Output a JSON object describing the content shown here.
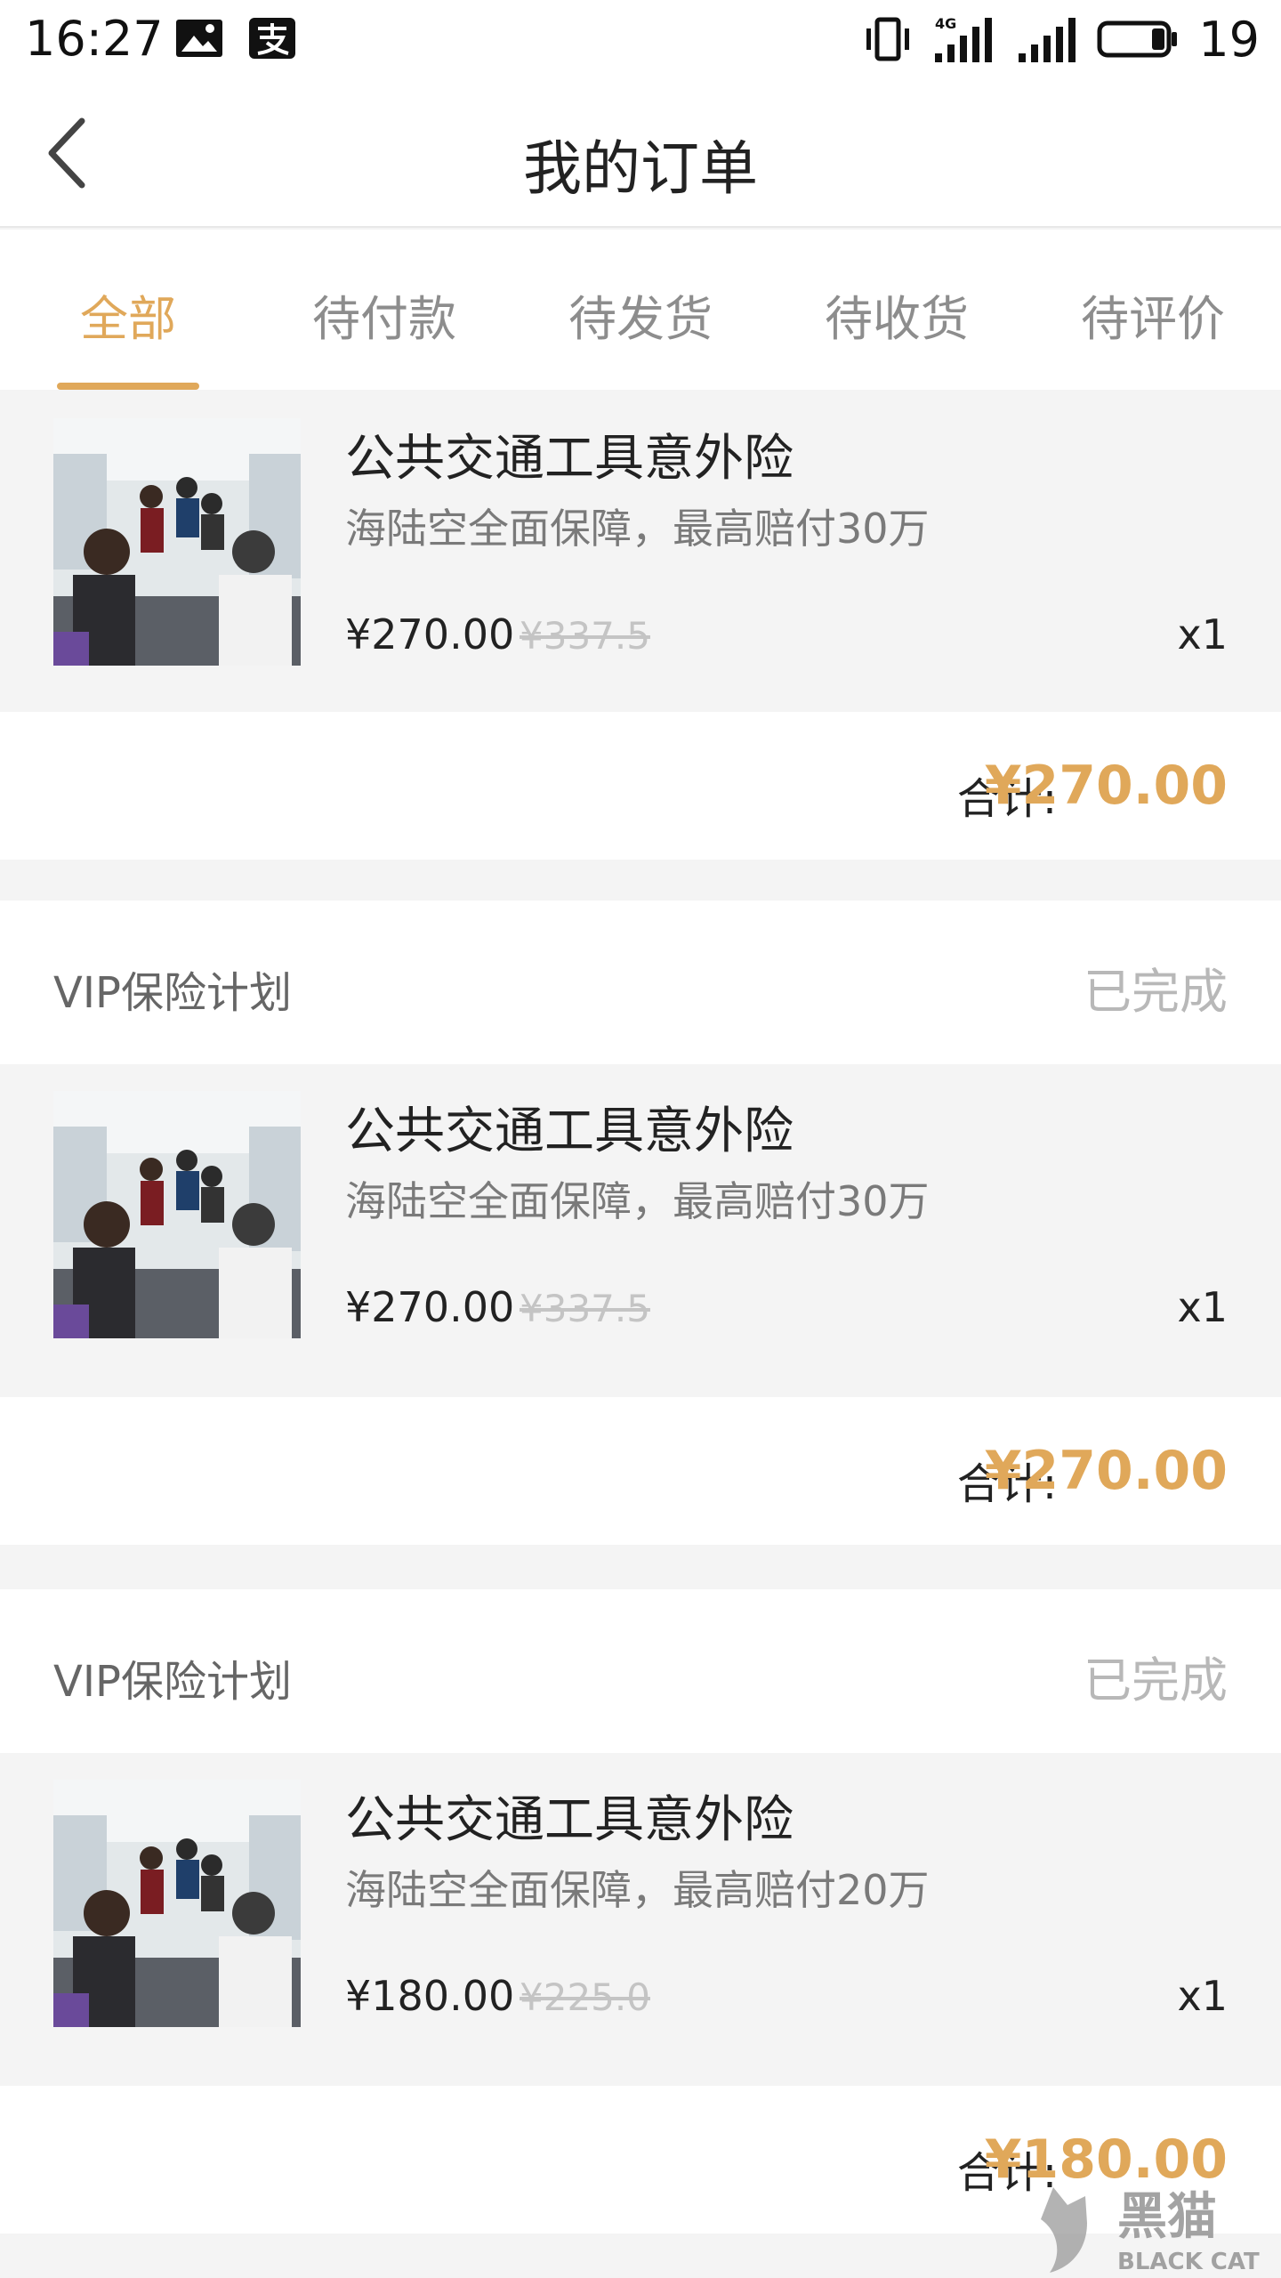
{
  "status_bar": {
    "time": "16:27",
    "battery": "19",
    "network": "4G",
    "icons": [
      "image-icon",
      "alipay-icon",
      "vibrate-icon",
      "signal-4g-icon",
      "signal-icon",
      "battery-icon"
    ]
  },
  "header": {
    "title": "我的订单",
    "back_icon": "chevron-left-icon"
  },
  "tabs": [
    {
      "label": "全部",
      "active": true
    },
    {
      "label": "待付款",
      "active": false
    },
    {
      "label": "待发货",
      "active": false
    },
    {
      "label": "待收货",
      "active": false
    },
    {
      "label": "待评价",
      "active": false
    }
  ],
  "orders": [
    {
      "product": {
        "name": "公共交通工具意外险",
        "desc": "海陆空全面保障，最高赔付30万",
        "price": "¥270.00",
        "original_price": "¥337.5",
        "qty": "x1"
      },
      "total_label": "合计:",
      "total": "¥270.00"
    },
    {
      "shop": "VIP保险计划",
      "status": "已完成",
      "product": {
        "name": "公共交通工具意外险",
        "desc": "海陆空全面保障，最高赔付30万",
        "price": "¥270.00",
        "original_price": "¥337.5",
        "qty": "x1"
      },
      "total_label": "合计:",
      "total": "¥270.00"
    },
    {
      "shop": "VIP保险计划",
      "status": "已完成",
      "product": {
        "name": "公共交通工具意外险",
        "desc": "海陆空全面保障，最高赔付20万",
        "price": "¥180.00",
        "original_price": "¥225.0",
        "qty": "x1"
      },
      "total_label": "合计:",
      "total": "¥180.00"
    }
  ],
  "watermark": {
    "text_cn": "黑猫",
    "text_en": "BLACK CAT"
  },
  "colors": {
    "accent": "#e0a85a",
    "background": "#f4f4f4",
    "muted": "#8d8d8d"
  }
}
